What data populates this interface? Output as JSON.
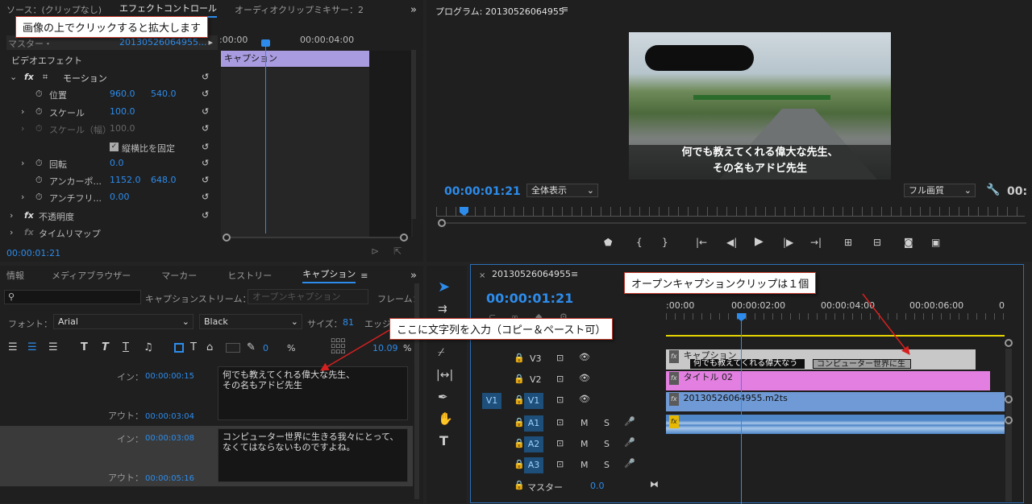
{
  "annotations": {
    "top_left": "画像の上でクリックすると拡大します",
    "input_text": "ここに文字列を入力（コピー＆ペースト可）",
    "open_caption": "オープンキャプションクリップは１個"
  },
  "effect_panel": {
    "tabs": [
      "ソース：(クリップなし)",
      "エフェクトコントロール",
      "オーディオクリップミキサー：2"
    ],
    "source_label": "マスター・",
    "source_clip": "20130526064955...",
    "video_effects": "ビデオエフェクト",
    "motion": "モーション",
    "position_label": "位置",
    "position_x": "960.0",
    "position_y": "540.0",
    "scale_label": "スケール",
    "scale_value": "100.0",
    "scale_width_label": "スケール（幅）",
    "scale_width_value": "100.0",
    "uniform_scale": "縦横比を固定",
    "rotation_label": "回転",
    "rotation_value": "0.0",
    "anchor_label": "アンカーポ...",
    "anchor_x": "1152.0",
    "anchor_y": "648.0",
    "antiflicker_label": "アンチフリ...",
    "antiflicker_value": "0.00",
    "opacity": "不透明度",
    "time_remap": "タイムリマップ",
    "timecode": "00:00:01:21",
    "ruler_start": ":00:00",
    "ruler_mid": "00:00:04:00",
    "caption_clip": "キャプション"
  },
  "program": {
    "title": "プログラム: 20130526064955",
    "timecode": "00:00:01:21",
    "fit": "全体表示",
    "quality": "フル画質",
    "timecode_right": "00:",
    "subtitle_line1": "何でも教えてくれる偉大な先生、",
    "subtitle_line2": "その名もアドビ先生"
  },
  "caption_panel": {
    "tabs": [
      "情報",
      "メディアブラウザー",
      "マーカー",
      "ヒストリー",
      "キャプション"
    ],
    "stream_label": "キャプションストリーム：",
    "stream_value": "オープンキャプション",
    "frame_label": "フレーム：",
    "font_label": "フォント：",
    "font_value": "Arial",
    "style_value": "Black",
    "size_label": "サイズ：",
    "size_value": "81",
    "edge_label": "エッジ",
    "opacity_value": "0",
    "opacity_unit": "%",
    "pct_value": "10.09",
    "pct_unit": "%",
    "entries": [
      {
        "in_label": "イン：",
        "in": "00:00:00:15",
        "out_label": "アウト：",
        "out": "00:00:03:04",
        "text1": "何でも教えてくれる偉大な先生、",
        "text2": "その名もアドビ先生"
      },
      {
        "in_label": "イン：",
        "in": "00:00:03:08",
        "out_label": "アウト：",
        "out": "00:00:05:16",
        "text1": "コンピューター世界に生きる我々にとって、",
        "text2": "なくてはならないものですよね。"
      }
    ]
  },
  "timeline": {
    "sequence": "20130526064955",
    "timecode": "00:00:01:21",
    "ruler": [
      ":00:00",
      "00:00:02:00",
      "00:00:04:00",
      "00:00:06:00",
      "0"
    ],
    "tracks": {
      "v3": "V3",
      "v2": "V2",
      "v1": "V1",
      "v1_src": "V1",
      "a1": "A1",
      "a2": "A2",
      "a3": "A3",
      "master": "マスター",
      "master_value": "0.0",
      "m": "M",
      "s": "S"
    },
    "clips": {
      "caption": "キャプション",
      "caption_sub1": "何でも教えてくれる偉大なう",
      "caption_sub2": "コンピューター世界に生",
      "title": "タイトル 02",
      "video": "20130526064955.m2ts"
    }
  },
  "colors": {
    "accent_blue": "#2d8ceb",
    "caption_clip": "#a99be0",
    "title_clip": "#e27fe0",
    "video_clip": "#6f9ad6",
    "audio_clip": "#4f87c8",
    "track_on": "#1d4f7a"
  }
}
